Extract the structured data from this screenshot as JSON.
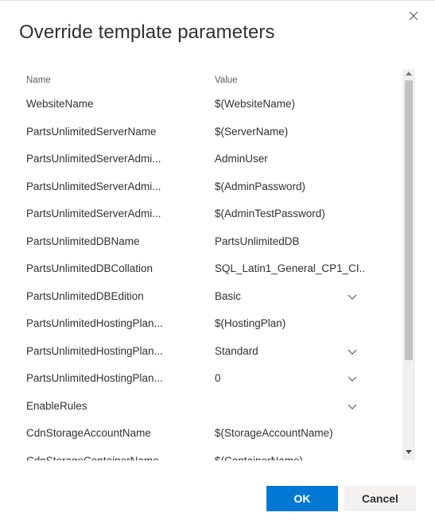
{
  "dialog": {
    "title": "Override template parameters",
    "columns": {
      "name": "Name",
      "value": "Value"
    },
    "rows": [
      {
        "name": "WebsiteName",
        "value": "$(WebsiteName)",
        "dropdown": false
      },
      {
        "name": "PartsUnlimitedServerName",
        "value": "$(ServerName)",
        "dropdown": false
      },
      {
        "name": "PartsUnlimitedServerAdmi...",
        "value": "AdminUser",
        "dropdown": false
      },
      {
        "name": "PartsUnlimitedServerAdmi...",
        "value": "$(AdminPassword)",
        "dropdown": false
      },
      {
        "name": "PartsUnlimitedServerAdmi...",
        "value": "$(AdminTestPassword)",
        "dropdown": false
      },
      {
        "name": "PartsUnlimitedDBName",
        "value": "PartsUnlimitedDB",
        "dropdown": false
      },
      {
        "name": "PartsUnlimitedDBCollation",
        "value": "SQL_Latin1_General_CP1_CI...",
        "dropdown": false
      },
      {
        "name": "PartsUnlimitedDBEdition",
        "value": "Basic",
        "dropdown": true
      },
      {
        "name": "PartsUnlimitedHostingPlan...",
        "value": "$(HostingPlan)",
        "dropdown": false
      },
      {
        "name": "PartsUnlimitedHostingPlan...",
        "value": "Standard",
        "dropdown": true
      },
      {
        "name": "PartsUnlimitedHostingPlan...",
        "value": "0",
        "dropdown": true
      },
      {
        "name": "EnableRules",
        "value": "",
        "dropdown": true
      },
      {
        "name": "CdnStorageAccountName",
        "value": "$(StorageAccountName)",
        "dropdown": false
      },
      {
        "name": "CdnStorageContainerName",
        "value": "$(ContainerName)",
        "dropdown": false
      }
    ],
    "buttons": {
      "ok": "OK",
      "cancel": "Cancel"
    },
    "icons": {
      "close": "close-icon",
      "chevron": "chevron-down-icon"
    },
    "colors": {
      "primary": "#0078d4",
      "secondary": "#f3f2f1",
      "text": "#323130"
    }
  }
}
